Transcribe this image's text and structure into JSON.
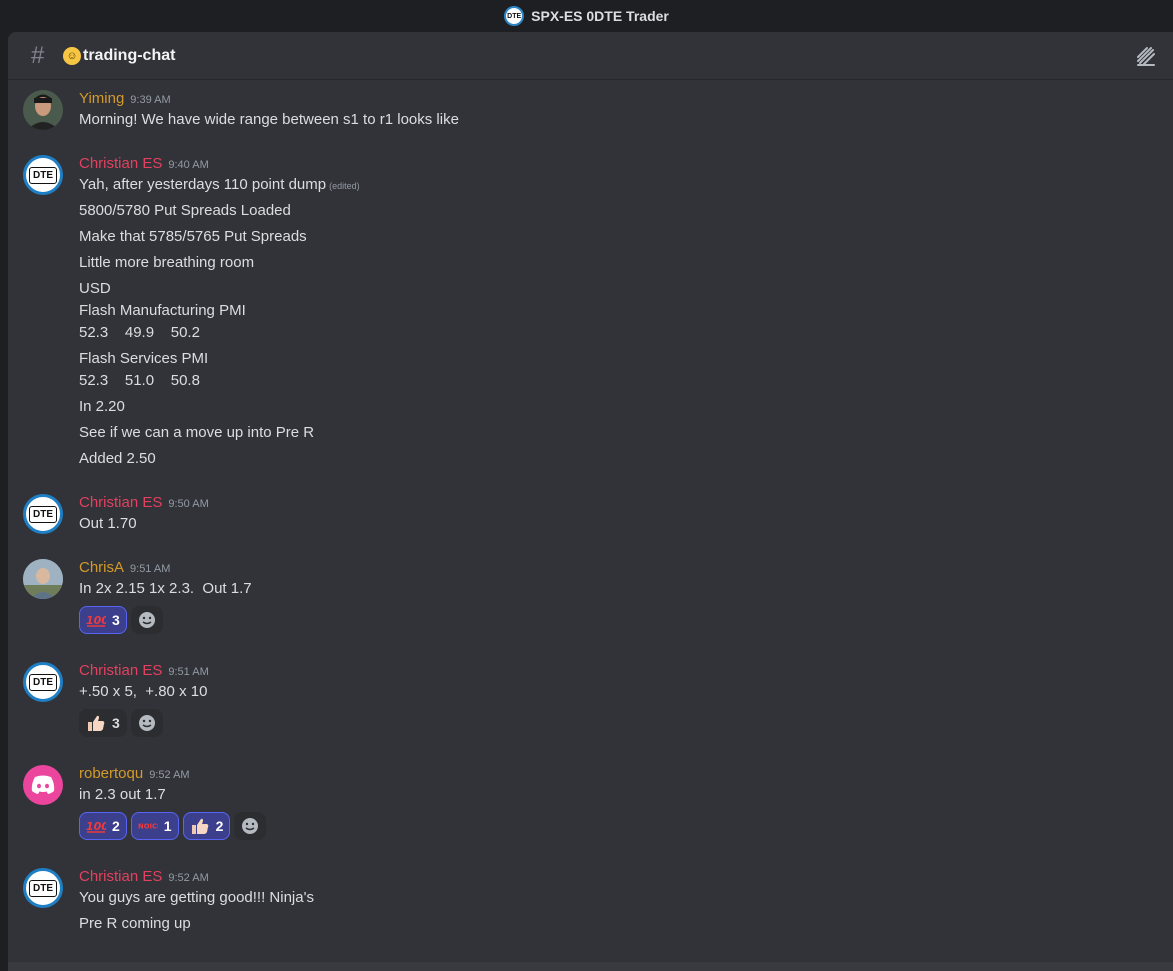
{
  "window": {
    "title": "SPX-ES 0DTE Trader",
    "server_icon_text": "DTE"
  },
  "channel": {
    "emoji": "grinning-face-emoji",
    "name": "trading-chat"
  },
  "colors": {
    "christian": "#e4405f",
    "yiming": "#d49a2a",
    "chrisa": "#d49a2a",
    "roberto": "#d49a2a"
  },
  "messages": [
    {
      "author": "Yiming",
      "time": "9:39 AM",
      "lines": [
        "Morning! We have wide range between s1 to r1 looks like"
      ]
    },
    {
      "author": "Christian ES",
      "time": "9:40 AM",
      "lines": [
        "Yah, after yesterdays 110 point dump",
        "5800/5780 Put Spreads Loaded",
        "Make that 5785/5765 Put Spreads",
        "Little more breathing room",
        "USD",
        "Flash Manufacturing PMI",
        "52.3    49.9    50.2",
        "Flash Services PMI",
        "52.3    51.0    50.8",
        "In 2.20",
        "See if we can a move up into Pre R",
        "Added 2.50"
      ],
      "edited": "(edited)"
    },
    {
      "author": "Christian ES",
      "time": "9:50 AM",
      "lines": [
        "Out 1.70"
      ]
    },
    {
      "author": "ChrisA",
      "time": "9:51 AM",
      "lines": [
        "In 2x 2.15 1x 2.3.  Out 1.7"
      ],
      "reactions": [
        {
          "emoji": "hundred-points-emoji",
          "count": "3"
        }
      ]
    },
    {
      "author": "Christian ES",
      "time": "9:51 AM",
      "lines": [
        "+.50 x 5,  +.80 x 10"
      ],
      "reactions": [
        {
          "emoji": "thumbs-up-emoji",
          "count": "3"
        }
      ]
    },
    {
      "author": "robertoqu",
      "time": "9:52 AM",
      "lines": [
        "in 2.3 out 1.7"
      ],
      "reactions": [
        {
          "emoji": "hundred-points-emoji",
          "count": "2"
        },
        {
          "emoji": "noice-emoji",
          "label": "NOICE",
          "count": "1"
        },
        {
          "emoji": "thumbs-up-emoji",
          "count": "2"
        }
      ]
    },
    {
      "author": "Christian ES",
      "time": "9:52 AM",
      "lines": [
        "You guys are getting good!!! Ninja's",
        "Pre R coming up"
      ]
    }
  ]
}
